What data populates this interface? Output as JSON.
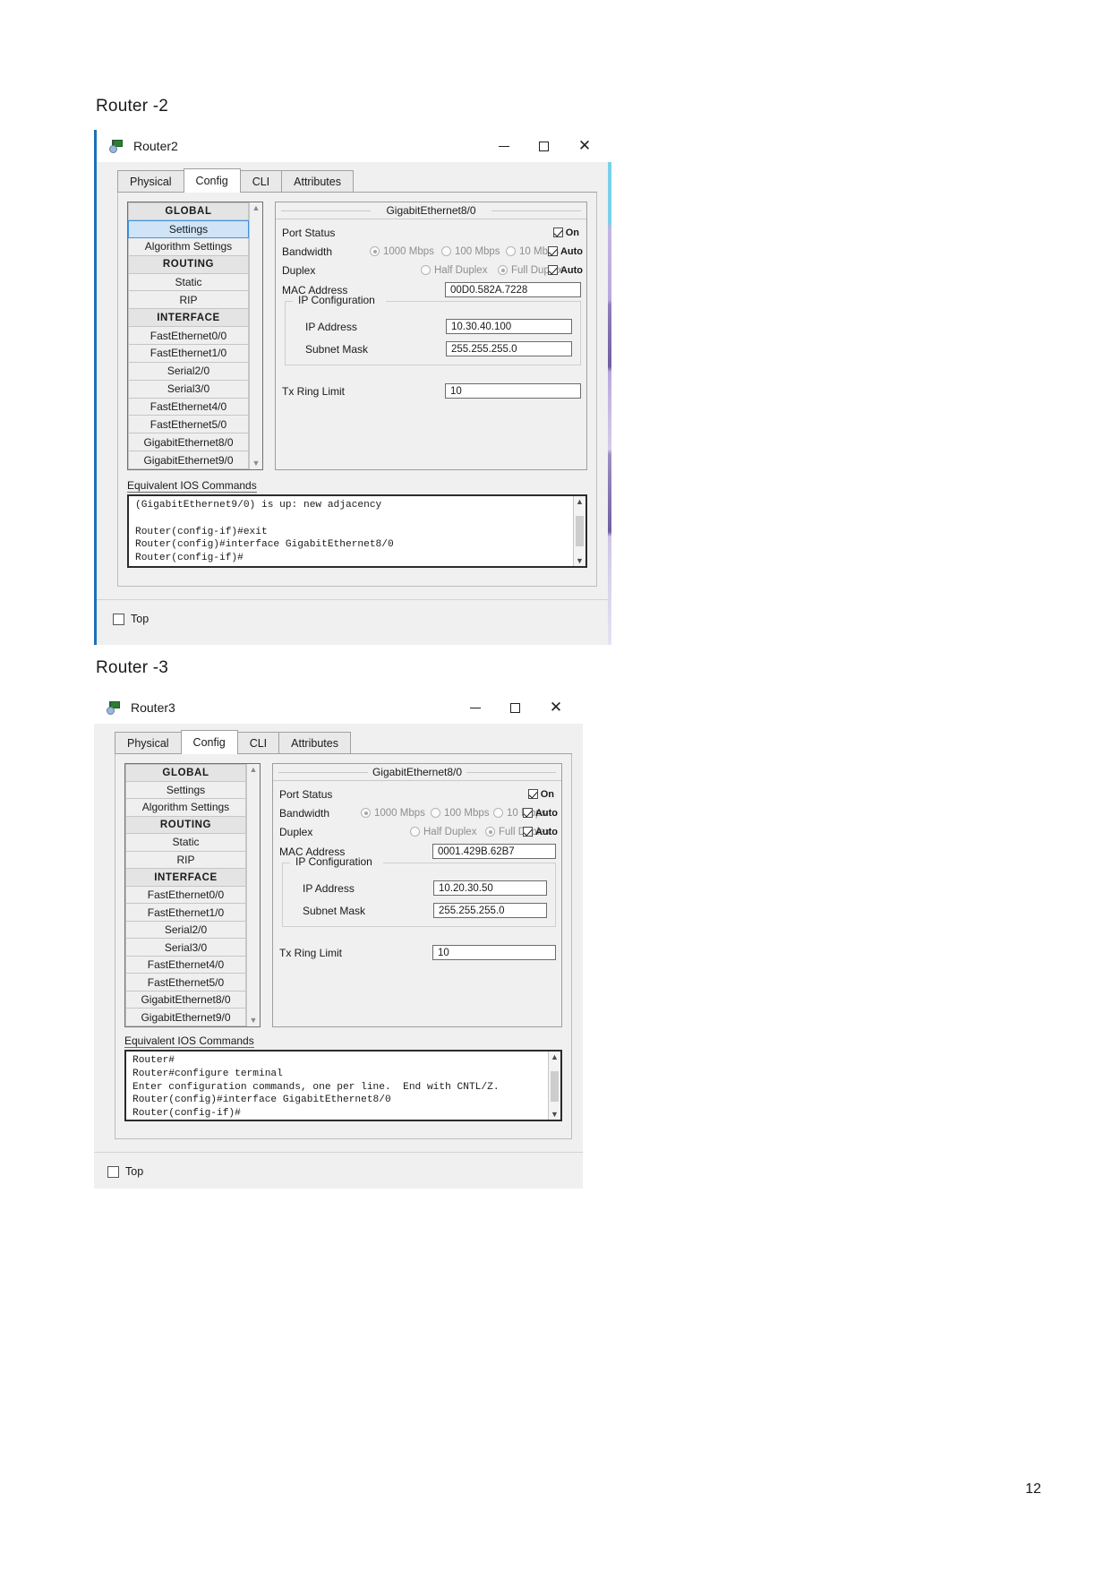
{
  "document": {
    "heading_router2": "Router -2",
    "heading_router3": "Router -3",
    "page_number": "12"
  },
  "common": {
    "tabs": [
      {
        "label": "Physical",
        "active": false
      },
      {
        "label": "Config",
        "active": true
      },
      {
        "label": "CLI",
        "active": false
      },
      {
        "label": "Attributes",
        "active": false
      }
    ],
    "sidebar_items": [
      {
        "label": "GLOBAL",
        "type": "header"
      },
      {
        "label": "Settings",
        "type": "item"
      },
      {
        "label": "Algorithm Settings",
        "type": "item"
      },
      {
        "label": "ROUTING",
        "type": "header"
      },
      {
        "label": "Static",
        "type": "item"
      },
      {
        "label": "RIP",
        "type": "item"
      },
      {
        "label": "INTERFACE",
        "type": "header"
      },
      {
        "label": "FastEthernet0/0",
        "type": "item"
      },
      {
        "label": "FastEthernet1/0",
        "type": "item"
      },
      {
        "label": "Serial2/0",
        "type": "item"
      },
      {
        "label": "Serial3/0",
        "type": "item"
      },
      {
        "label": "FastEthernet4/0",
        "type": "item"
      },
      {
        "label": "FastEthernet5/0",
        "type": "item"
      },
      {
        "label": "GigabitEthernet8/0",
        "type": "item"
      },
      {
        "label": "GigabitEthernet9/0",
        "type": "item"
      }
    ],
    "sidebar_selected": "Settings",
    "scroll_up_icon": "chevron-up-icon",
    "scroll_down_icon": "chevron-down-icon",
    "labels": {
      "interface_title": "GigabitEthernet8/0",
      "port_status": "Port Status",
      "bandwidth": "Bandwidth",
      "duplex": "Duplex",
      "mac_address": "MAC Address",
      "ip_configuration": "IP Configuration",
      "ip_address": "IP Address",
      "subnet_mask": "Subnet Mask",
      "tx_ring_limit": "Tx Ring Limit",
      "ios_commands": "Equivalent IOS Commands",
      "top_checkbox": "Top"
    },
    "bandwidth_options": [
      {
        "label": "1000 Mbps",
        "selected": true
      },
      {
        "label": "100 Mbps",
        "selected": false
      },
      {
        "label": "10 Mbps",
        "selected": false
      }
    ],
    "duplex_options": [
      {
        "label": "Half Duplex",
        "selected": false
      },
      {
        "label": "Full Duplex",
        "selected": true
      }
    ],
    "on_label": "On",
    "auto_label": "Auto",
    "port_status_on": true,
    "bandwidth_auto": true,
    "duplex_auto": true,
    "top_checked": false,
    "colors": {
      "window_chrome": "#f0f0f0",
      "selection_blue": "#cfe4f7",
      "selection_border": "#3f93dd",
      "accent_left_bar": "#1d6fb8"
    }
  },
  "router2": {
    "window_title": "Router2",
    "title_icon": "router-flag-icon",
    "minimize_icon": "minimize-icon",
    "maximize_icon": "maximize-icon",
    "close_icon": "close-icon",
    "mac_address": "00D0.582A.7228",
    "ip_address": "10.30.40.100",
    "subnet_mask": "255.255.255.0",
    "tx_ring_limit": "10",
    "console_text": "(GigabitEthernet9/0) is up: new adjacency\n\nRouter(config-if)#exit\nRouter(config)#interface GigabitEthernet8/0\nRouter(config-if)#"
  },
  "router3": {
    "window_title": "Router3",
    "title_icon": "router-flag-icon",
    "minimize_icon": "minimize-icon",
    "maximize_icon": "maximize-icon",
    "close_icon": "close-icon",
    "mac_address": "0001.429B.62B7",
    "ip_address": "10.20.30.50",
    "subnet_mask": "255.255.255.0",
    "tx_ring_limit": "10",
    "console_text": "Router#\nRouter#configure terminal\nEnter configuration commands, one per line.  End with CNTL/Z.\nRouter(config)#interface GigabitEthernet8/0\nRouter(config-if)#"
  }
}
